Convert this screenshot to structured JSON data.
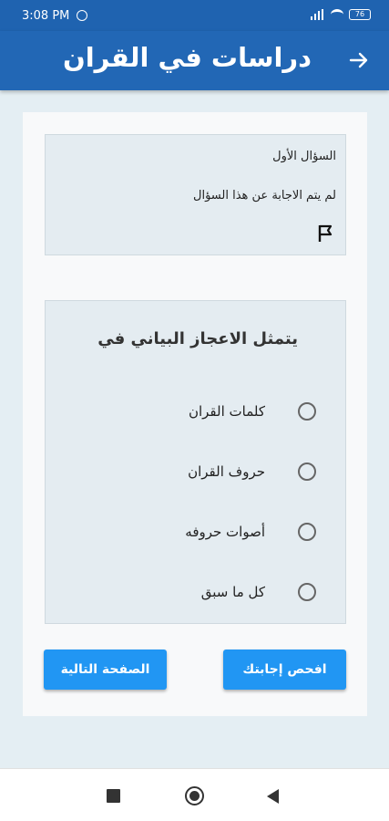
{
  "status_bar": {
    "time": "3:08 PM",
    "battery": "76"
  },
  "app_bar": {
    "title": "دراسات في القران",
    "back_icon": "arrow-right-icon"
  },
  "question_info": {
    "number_label": "السؤال الأول",
    "status_label": "لم يتم الاجابة عن هذا السؤال",
    "flag_icon": "flag-icon"
  },
  "question": {
    "text": "يتمثل الاعجاز البياني في",
    "options": [
      {
        "label": "كلمات القران"
      },
      {
        "label": "حروف القران"
      },
      {
        "label": "أصوات حروفه"
      },
      {
        "label": "كل ما سبق"
      }
    ]
  },
  "buttons": {
    "check_label": "افحص إجابتك",
    "next_label": "الصفحة التالية"
  },
  "colors": {
    "app_bar": "#2267b5",
    "button": "#2196f3",
    "background": "#e4eef3"
  }
}
